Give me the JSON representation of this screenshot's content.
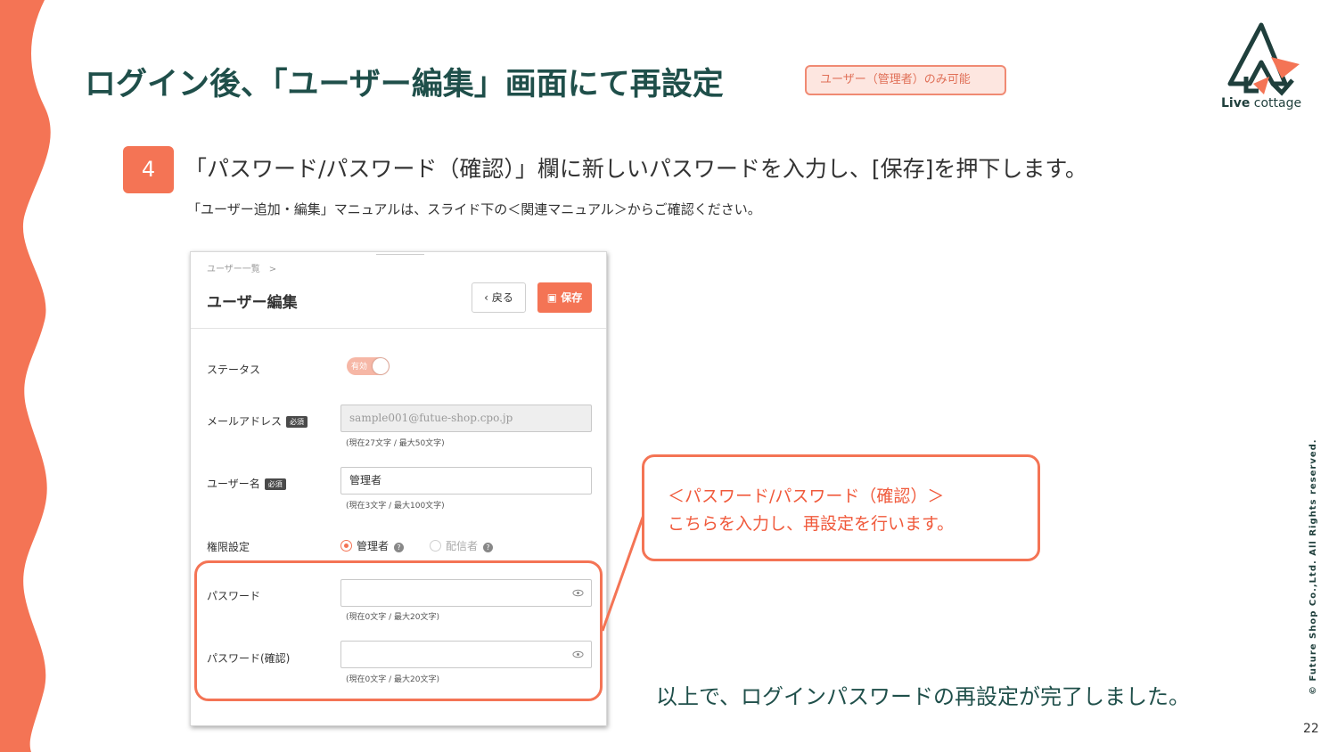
{
  "slide": {
    "title": "ログイン後、「ユーザー編集」画面にて再設定",
    "role_badge": "ユーザー（管理者）のみ可能",
    "logo_text_bold": "Live",
    "logo_text_rest": " cottage",
    "step_number": "4",
    "step_title": "「パスワード/パスワード（確認）」欄に新しいパスワードを入力し、[保存]を押下します。",
    "step_note": "「ユーザー追加・編集」マニュアルは、スライド下の＜関連マニュアル＞からご確認ください。",
    "callout_line1": "＜パスワード/パスワード（確認）＞",
    "callout_line2": "こちらを入力し、再設定を行います。",
    "done_message": "以上で、ログインパスワードの再設定が完了しました。",
    "copyright": "© Future Shop Co.,Ltd. All Rights reserved.",
    "page_number": "22",
    "accent_color": "#f47455",
    "title_color": "#1f4f4a"
  },
  "screenshot": {
    "breadcrumb": "ユーザー一覧　>",
    "page_heading": "ユーザー編集",
    "back_label": "戻る",
    "save_label": "保存",
    "required_badge": "必須",
    "status": {
      "label": "ステータス",
      "toggle_text": "有効",
      "toggle_on": true
    },
    "email": {
      "label": "メールアドレス",
      "value": "sample001@futue-shop.cpo.jp",
      "hint": "(現在27文字 / 最大50文字)"
    },
    "username": {
      "label": "ユーザー名",
      "value": "管理者",
      "hint": "(現在3文字 / 最大100文字)"
    },
    "permission": {
      "label": "権限設定",
      "option_admin": "管理者",
      "option_delivery": "配信者",
      "selected": "管理者"
    },
    "password": {
      "label": "パスワード",
      "value": "",
      "hint": "(現在0文字 / 最大20文字)"
    },
    "password_confirm": {
      "label": "パスワード(確認)",
      "value": "",
      "hint": "(現在0文字 / 最大20文字)"
    }
  }
}
